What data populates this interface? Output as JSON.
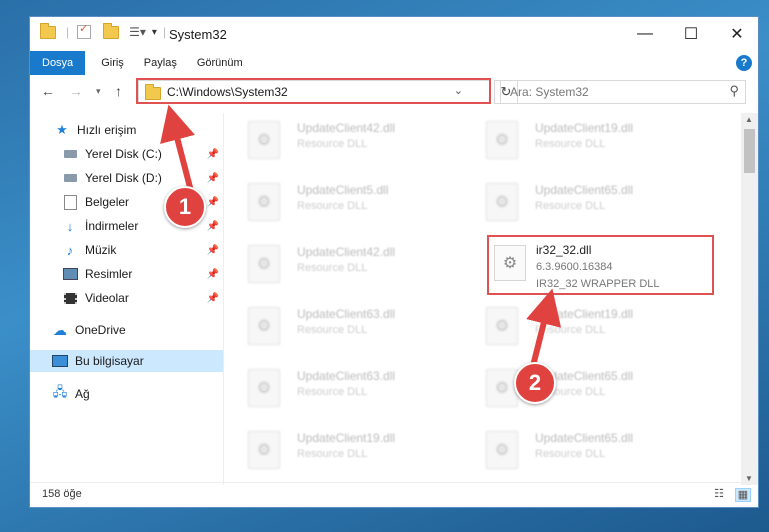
{
  "window": {
    "title": "System32"
  },
  "controls": {
    "minimize": "—",
    "maximize": "☐",
    "close": "✕"
  },
  "ribbon": {
    "tabs": [
      "Dosya",
      "Giriş",
      "Paylaş",
      "Görünüm"
    ],
    "help": "?"
  },
  "address": {
    "path": "C:\\Windows\\System32"
  },
  "search": {
    "placeholder": "Ara: System32"
  },
  "nav": {
    "items": [
      {
        "label": "Hızlı erişim",
        "icon": "star-icon",
        "pinned": false
      },
      {
        "label": "Yerel Disk (C:)",
        "icon": "drive-icon",
        "pinned": true
      },
      {
        "label": "Yerel Disk (D:)",
        "icon": "drive-icon",
        "pinned": true
      },
      {
        "label": "Belgeler",
        "icon": "documents-icon",
        "pinned": true
      },
      {
        "label": "İndirmeler",
        "icon": "download-icon",
        "pinned": true
      },
      {
        "label": "Müzik",
        "icon": "music-icon",
        "pinned": true
      },
      {
        "label": "Resimler",
        "icon": "pictures-icon",
        "pinned": true
      },
      {
        "label": "Videolar",
        "icon": "videos-icon",
        "pinned": true
      },
      {
        "label": "OneDrive",
        "icon": "cloud-icon",
        "pinned": false
      },
      {
        "label": "Bu bilgisayar",
        "icon": "computer-icon",
        "pinned": false
      },
      {
        "label": "Ağ",
        "icon": "network-icon",
        "pinned": false
      }
    ]
  },
  "files": {
    "left": [
      {
        "name": "UpdateClient42.dll",
        "desc": "Resource DLL"
      },
      {
        "name": "UpdateClient5.dll",
        "desc": "Resource DLL"
      },
      {
        "name": "UpdateClient42.dll",
        "desc": "Resource DLL"
      },
      {
        "name": "UpdateClient63.dll",
        "desc": "Resource DLL"
      },
      {
        "name": "UpdateClient63.dll",
        "desc": "Resource DLL"
      },
      {
        "name": "UpdateClient19.dll",
        "desc": "Resource DLL"
      }
    ],
    "right": [
      {
        "name": "UpdateClient19.dll",
        "desc": "Resource DLL"
      },
      {
        "name": "UpdateClient65.dll",
        "desc": "Resource DLL"
      },
      {
        "name": "UpdateClient19.dll",
        "desc": "Resource DLL"
      },
      {
        "name": "UpdateClient65.dll",
        "desc": "Resource DLL"
      },
      {
        "name": "UpdateClient65.dll",
        "desc": "Resource DLL"
      }
    ],
    "featured": {
      "name": "ir32_32.dll",
      "version": "6.3.9600.16384",
      "desc": "IR32_32 WRAPPER DLL"
    }
  },
  "status": {
    "count": "158 öğe"
  },
  "annotations": {
    "step1": "1",
    "step2": "2"
  },
  "colors": {
    "accent": "#1979ca",
    "highlight": "#e05252"
  }
}
